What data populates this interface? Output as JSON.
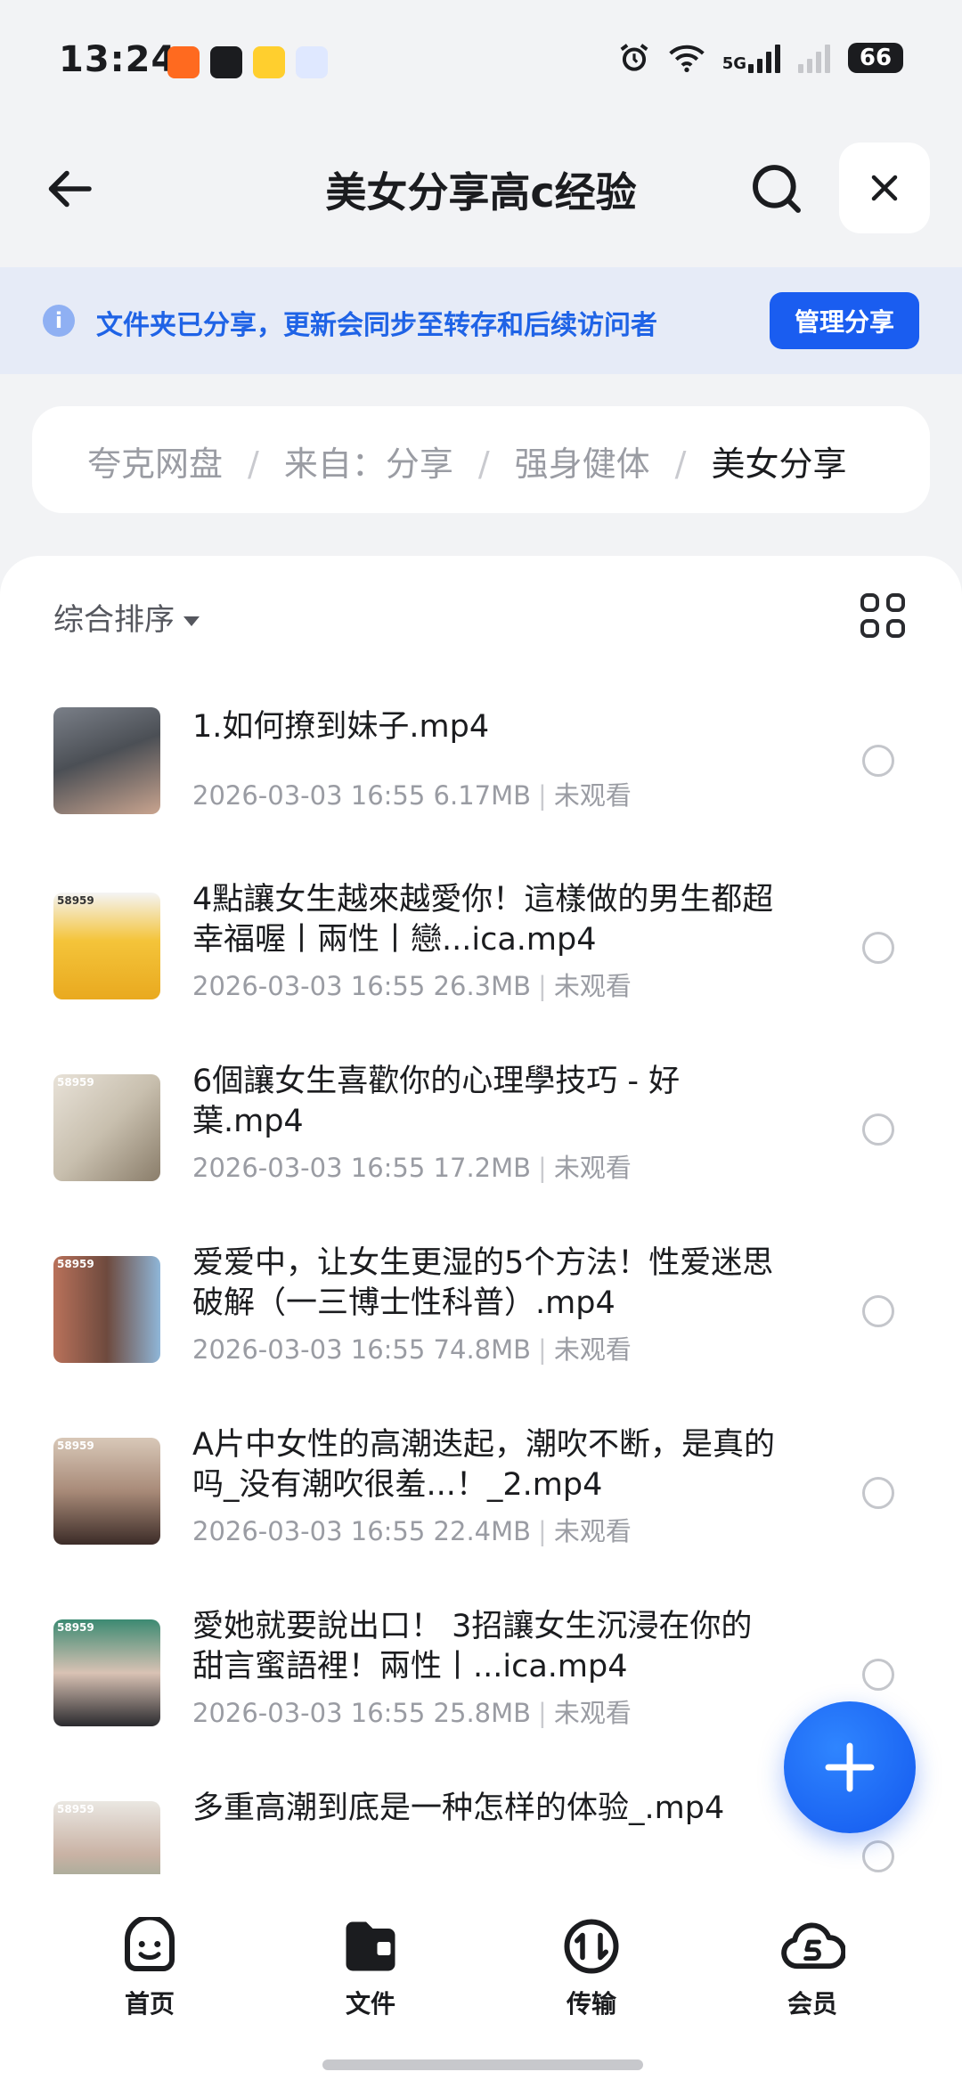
{
  "status_bar": {
    "time": "13:24",
    "network": "5G",
    "battery": "66"
  },
  "header": {
    "title": "美女分享高c经验"
  },
  "share_banner": {
    "text": "文件夹已分享，更新会同步至转存和后续访问者",
    "button": "管理分享"
  },
  "breadcrumb": [
    "夸克网盘",
    "来自：分享",
    "强身健体",
    "美女分享"
  ],
  "sort_label": "综合排序",
  "files": [
    {
      "name": "1.如何撩到妹子.mp4",
      "date": "2026-03-03 16:55",
      "size": "6.17MB",
      "status": "未观看",
      "thumb_tag": ""
    },
    {
      "name": "4點讓女生越來越愛你！這樣做的男生都超幸福喔丨兩性丨戀...ica.mp4",
      "date": "2026-03-03 16:55",
      "size": "26.3MB",
      "status": "未观看",
      "thumb_tag": "58959"
    },
    {
      "name": "6個讓女生喜歡你的心理學技巧 - 好葉.mp4",
      "date": "2026-03-03 16:55",
      "size": "17.2MB",
      "status": "未观看",
      "thumb_tag": "58959"
    },
    {
      "name": "爱爱中，让女生更湿的5个方法！性爱迷思破解（一三博士性科普）.mp4",
      "date": "2026-03-03 16:55",
      "size": "74.8MB",
      "status": "未观看",
      "thumb_tag": "58959"
    },
    {
      "name": "A片中女性的高潮迭起，潮吹不断，是真的吗_没有潮吹很羞...！_2.mp4",
      "date": "2026-03-03 16:55",
      "size": "22.4MB",
      "status": "未观看",
      "thumb_tag": "58959"
    },
    {
      "name": "愛她就要說出口！ 3招讓女生沉浸在你的甜言蜜語裡！兩性丨...ica.mp4",
      "date": "2026-03-03 16:55",
      "size": "25.8MB",
      "status": "未观看",
      "thumb_tag": "58959"
    },
    {
      "name": "多重高潮到底是一种怎样的体验_.mp4",
      "date": "",
      "size": "",
      "status": "",
      "thumb_tag": "58959"
    }
  ],
  "nav": [
    {
      "label": "首页"
    },
    {
      "label": "文件"
    },
    {
      "label": "传输"
    },
    {
      "label": "会员"
    }
  ],
  "colors": {
    "accent": "#1a5df0",
    "banner_bg": "#e6ebf7",
    "banner_text": "#1f63e6"
  }
}
